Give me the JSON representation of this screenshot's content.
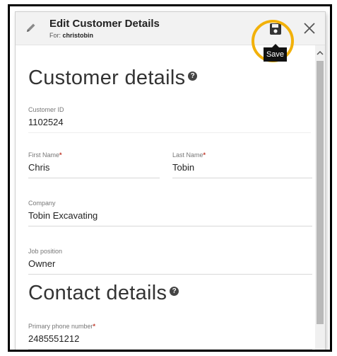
{
  "dialog": {
    "title": "Edit Customer Details",
    "subtitle_prefix": "For:",
    "subtitle_user": "christobin",
    "save_tooltip": "Save",
    "accent_color": "#f2b10a"
  },
  "sections": {
    "customer_title": "Customer details",
    "contact_title": "Contact details",
    "help_glyph": "?"
  },
  "fields": {
    "customer_id": {
      "label": "Customer ID",
      "value": "1102524"
    },
    "first_name": {
      "label": "First Name",
      "value": "Chris",
      "required_mark": "*"
    },
    "last_name": {
      "label": "Last Name",
      "value": "Tobin",
      "required_mark": "*"
    },
    "company": {
      "label": "Company",
      "value": "Tobin Excavating"
    },
    "job_position": {
      "label": "Job position",
      "value": "Owner"
    },
    "primary_phone": {
      "label": "Primary phone number",
      "value": "2485551212",
      "required_mark": "*"
    }
  },
  "icons": {
    "edit": "pencil-icon",
    "save": "floppy-disk-icon",
    "close": "close-icon",
    "help": "help-circle-icon",
    "scroll_up": "chevron-up-icon"
  }
}
